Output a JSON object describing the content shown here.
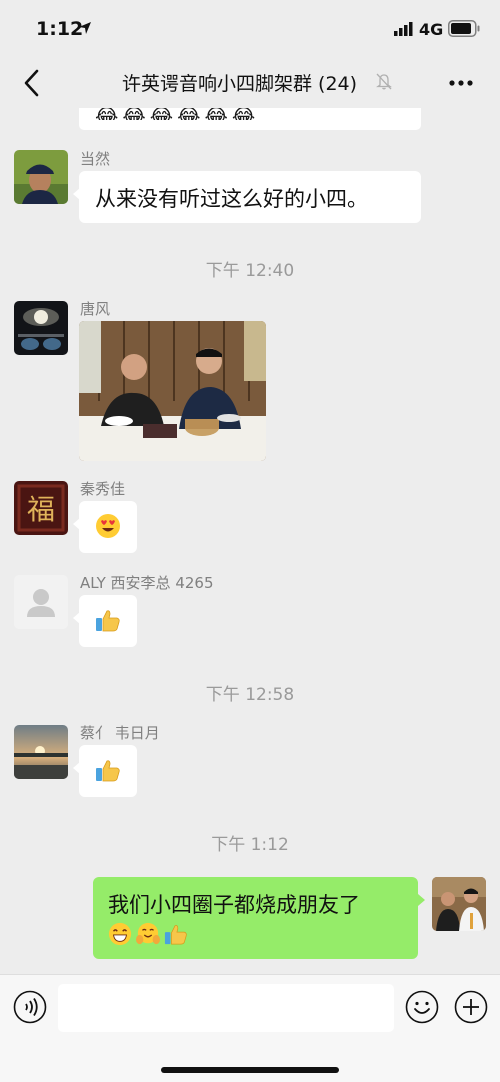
{
  "status_bar": {
    "time": "1:12",
    "network": "4G"
  },
  "chat": {
    "title": "许英谔音响小四脚架群 (24)"
  },
  "messages": {
    "m1": {
      "sender": "当然",
      "text": "从来没有听过这么好的小四。"
    },
    "time1": "下午 12:40",
    "m2": {
      "sender": "唐风"
    },
    "m3": {
      "sender": "秦秀佳"
    },
    "m4": {
      "sender": "ALY 西安李总 4265"
    },
    "time2": "下午 12:58",
    "m5": {
      "sender": "蔡亻 韦日月"
    },
    "time3": "下午 1:12",
    "mine": {
      "text": "我们小四圈子都烧成朋友了"
    }
  },
  "input": {
    "placeholder": ""
  },
  "icons": {
    "back": "chevron-left-icon",
    "mute": "bell-slash-icon",
    "more": "ellipsis-icon",
    "voice": "voice-icon",
    "emoji": "smiley-icon",
    "plus": "plus-circle-icon"
  },
  "colors": {
    "my_bubble": "#95ec69",
    "background": "#ededed"
  }
}
